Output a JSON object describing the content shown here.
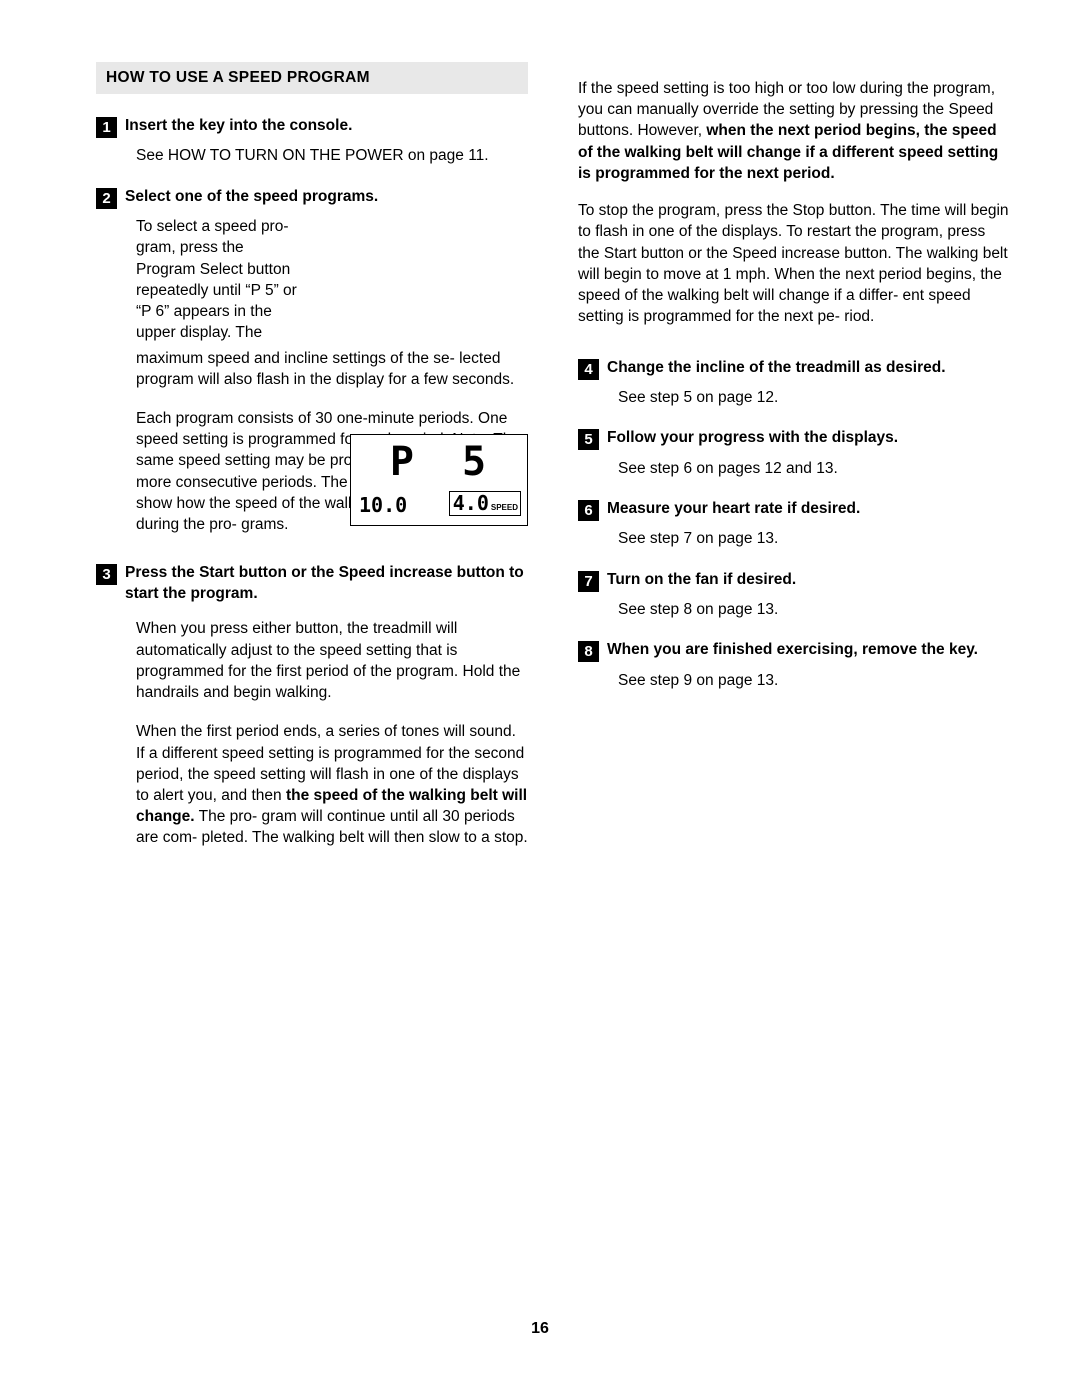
{
  "document": {
    "page_number": "16",
    "section_title": "HOW TO USE A SPEED PROGRAM"
  },
  "left_column": {
    "step1": {
      "number": "1",
      "title": "Insert the key into the console.",
      "body": "See HOW TO TURN ON THE POWER on page 11."
    },
    "step2": {
      "number": "2",
      "title": "Select one of the speed programs.",
      "body_wrap": "To select a speed pro- gram, press the Program Select button repeatedly until “P 5” or “P 6” appears in the upper display. The maximum speed and incline settings of the se- lected program will also flash in the display for a few seconds.",
      "body_narrow": "To select a speed pro-\ngram, press the\nProgram Select button\nrepeatedly until “P 5” or\n“P 6” appears in the\nupper display. The",
      "body_full": "maximum speed and incline settings of the se- lected program will also flash in the display for a few seconds.",
      "paragraph2": "Each program consists of 30 one-minute periods. One speed setting is programmed for each period. Note: The same speed setting may be pro- grammed for two or more consecutive periods. The profiles on the console show how the speed of the walking belt will change during the pro- grams."
    },
    "step3": {
      "number": "3",
      "title": "Press the Start button or the Speed increase button to start the program.",
      "paragraph1": "When you press either button, the treadmill will automatically adjust to the speed setting that is programmed for the first period of the program. Hold the handrails and begin walking.",
      "paragraph2_part1": "When the first period ends, a series of tones will sound. If a different speed setting is programmed for the second period, the speed setting will flash in one of the displays to alert you, and then ",
      "paragraph2_bold1": "the speed of the walking belt will change.",
      "paragraph2_part2": " The pro- gram will continue until all 30 periods are com- pleted. The walking belt will then slow to a stop."
    },
    "console_display": {
      "upper_value": "P 5",
      "lower_left_value": "10.0",
      "lower_right_value": "4.0",
      "lower_right_label": "SPEED"
    }
  },
  "right_column": {
    "paragraph1_part1": "If the speed setting is too high or too low during the program, you can manually override the setting by pressing the Speed buttons. However, ",
    "paragraph1_bold": "when the next period begins, the speed of the walking belt will change if a different speed setting is programmed for the next period.",
    "paragraph2": "To stop the program, press the Stop button. The time will begin to flash in one of the displays. To restart the program, press the Start button or the Speed increase button. The walking belt will begin to move at 1 mph. When the next period begins, the speed of the walking belt will change if a differ- ent speed setting is programmed for the next pe- riod.",
    "step4": {
      "number": "4",
      "title": "Change the incline of the treadmill as desired.",
      "body": "See step 5 on page 12."
    },
    "step5": {
      "number": "5",
      "title": "Follow your progress with the displays.",
      "body": "See step 6 on pages 12 and 13."
    },
    "step6": {
      "number": "6",
      "title": "Measure your heart rate if desired.",
      "body": "See step 7 on page 13."
    },
    "step7": {
      "number": "7",
      "title": "Turn on the fan if desired.",
      "body": "See step 8 on page 13."
    },
    "step8": {
      "number": "8",
      "title": "When you are finished exercising, remove the key.",
      "body": "See step 9 on page 13."
    }
  }
}
